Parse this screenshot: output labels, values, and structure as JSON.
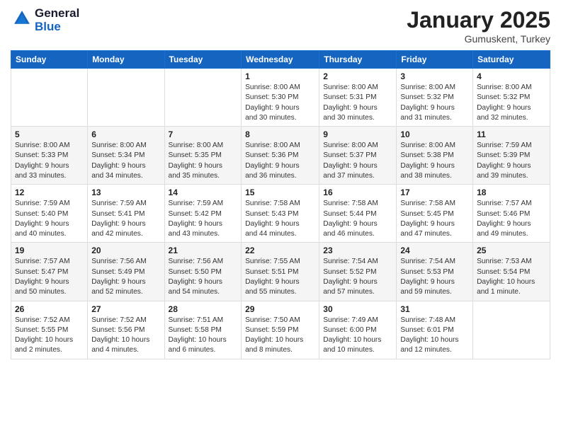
{
  "header": {
    "logo_line1": "General",
    "logo_line2": "Blue",
    "month": "January 2025",
    "location": "Gumuskent, Turkey"
  },
  "days_of_week": [
    "Sunday",
    "Monday",
    "Tuesday",
    "Wednesday",
    "Thursday",
    "Friday",
    "Saturday"
  ],
  "weeks": [
    [
      {
        "day": "",
        "info": ""
      },
      {
        "day": "",
        "info": ""
      },
      {
        "day": "",
        "info": ""
      },
      {
        "day": "1",
        "info": "Sunrise: 8:00 AM\nSunset: 5:30 PM\nDaylight: 9 hours\nand 30 minutes."
      },
      {
        "day": "2",
        "info": "Sunrise: 8:00 AM\nSunset: 5:31 PM\nDaylight: 9 hours\nand 30 minutes."
      },
      {
        "day": "3",
        "info": "Sunrise: 8:00 AM\nSunset: 5:32 PM\nDaylight: 9 hours\nand 31 minutes."
      },
      {
        "day": "4",
        "info": "Sunrise: 8:00 AM\nSunset: 5:32 PM\nDaylight: 9 hours\nand 32 minutes."
      }
    ],
    [
      {
        "day": "5",
        "info": "Sunrise: 8:00 AM\nSunset: 5:33 PM\nDaylight: 9 hours\nand 33 minutes."
      },
      {
        "day": "6",
        "info": "Sunrise: 8:00 AM\nSunset: 5:34 PM\nDaylight: 9 hours\nand 34 minutes."
      },
      {
        "day": "7",
        "info": "Sunrise: 8:00 AM\nSunset: 5:35 PM\nDaylight: 9 hours\nand 35 minutes."
      },
      {
        "day": "8",
        "info": "Sunrise: 8:00 AM\nSunset: 5:36 PM\nDaylight: 9 hours\nand 36 minutes."
      },
      {
        "day": "9",
        "info": "Sunrise: 8:00 AM\nSunset: 5:37 PM\nDaylight: 9 hours\nand 37 minutes."
      },
      {
        "day": "10",
        "info": "Sunrise: 8:00 AM\nSunset: 5:38 PM\nDaylight: 9 hours\nand 38 minutes."
      },
      {
        "day": "11",
        "info": "Sunrise: 7:59 AM\nSunset: 5:39 PM\nDaylight: 9 hours\nand 39 minutes."
      }
    ],
    [
      {
        "day": "12",
        "info": "Sunrise: 7:59 AM\nSunset: 5:40 PM\nDaylight: 9 hours\nand 40 minutes."
      },
      {
        "day": "13",
        "info": "Sunrise: 7:59 AM\nSunset: 5:41 PM\nDaylight: 9 hours\nand 42 minutes."
      },
      {
        "day": "14",
        "info": "Sunrise: 7:59 AM\nSunset: 5:42 PM\nDaylight: 9 hours\nand 43 minutes."
      },
      {
        "day": "15",
        "info": "Sunrise: 7:58 AM\nSunset: 5:43 PM\nDaylight: 9 hours\nand 44 minutes."
      },
      {
        "day": "16",
        "info": "Sunrise: 7:58 AM\nSunset: 5:44 PM\nDaylight: 9 hours\nand 46 minutes."
      },
      {
        "day": "17",
        "info": "Sunrise: 7:58 AM\nSunset: 5:45 PM\nDaylight: 9 hours\nand 47 minutes."
      },
      {
        "day": "18",
        "info": "Sunrise: 7:57 AM\nSunset: 5:46 PM\nDaylight: 9 hours\nand 49 minutes."
      }
    ],
    [
      {
        "day": "19",
        "info": "Sunrise: 7:57 AM\nSunset: 5:47 PM\nDaylight: 9 hours\nand 50 minutes."
      },
      {
        "day": "20",
        "info": "Sunrise: 7:56 AM\nSunset: 5:49 PM\nDaylight: 9 hours\nand 52 minutes."
      },
      {
        "day": "21",
        "info": "Sunrise: 7:56 AM\nSunset: 5:50 PM\nDaylight: 9 hours\nand 54 minutes."
      },
      {
        "day": "22",
        "info": "Sunrise: 7:55 AM\nSunset: 5:51 PM\nDaylight: 9 hours\nand 55 minutes."
      },
      {
        "day": "23",
        "info": "Sunrise: 7:54 AM\nSunset: 5:52 PM\nDaylight: 9 hours\nand 57 minutes."
      },
      {
        "day": "24",
        "info": "Sunrise: 7:54 AM\nSunset: 5:53 PM\nDaylight: 9 hours\nand 59 minutes."
      },
      {
        "day": "25",
        "info": "Sunrise: 7:53 AM\nSunset: 5:54 PM\nDaylight: 10 hours\nand 1 minute."
      }
    ],
    [
      {
        "day": "26",
        "info": "Sunrise: 7:52 AM\nSunset: 5:55 PM\nDaylight: 10 hours\nand 2 minutes."
      },
      {
        "day": "27",
        "info": "Sunrise: 7:52 AM\nSunset: 5:56 PM\nDaylight: 10 hours\nand 4 minutes."
      },
      {
        "day": "28",
        "info": "Sunrise: 7:51 AM\nSunset: 5:58 PM\nDaylight: 10 hours\nand 6 minutes."
      },
      {
        "day": "29",
        "info": "Sunrise: 7:50 AM\nSunset: 5:59 PM\nDaylight: 10 hours\nand 8 minutes."
      },
      {
        "day": "30",
        "info": "Sunrise: 7:49 AM\nSunset: 6:00 PM\nDaylight: 10 hours\nand 10 minutes."
      },
      {
        "day": "31",
        "info": "Sunrise: 7:48 AM\nSunset: 6:01 PM\nDaylight: 10 hours\nand 12 minutes."
      },
      {
        "day": "",
        "info": ""
      }
    ]
  ]
}
